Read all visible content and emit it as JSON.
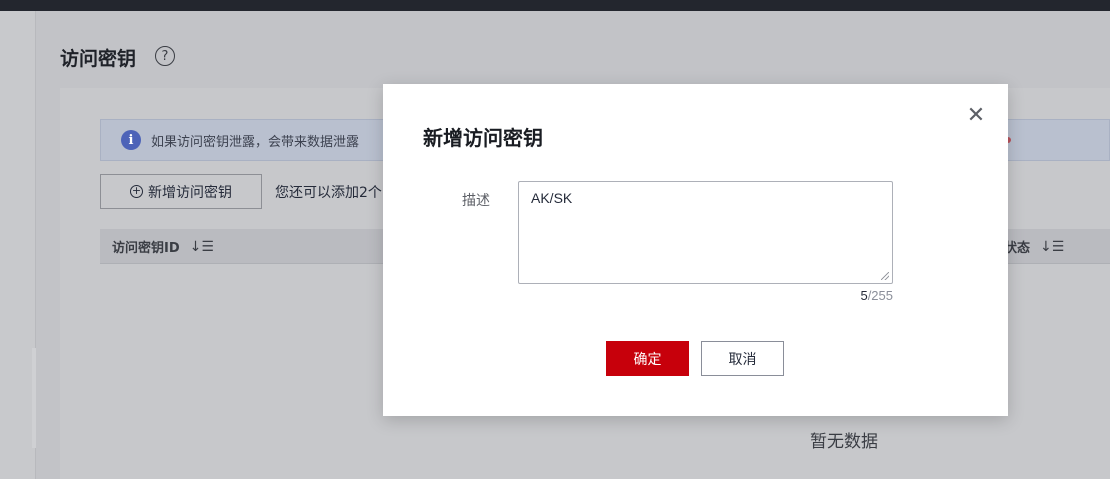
{
  "page": {
    "title": "访问密钥",
    "help_icon": "question-circle-icon"
  },
  "notice": {
    "icon": "info-icon",
    "text": "如果访问密钥泄露，会带来数据泄露"
  },
  "toolbar": {
    "add_button_label": "新增访问密钥",
    "limit_text": "您还可以添加2个"
  },
  "table": {
    "columns": [
      "访问密钥ID",
      "状态"
    ],
    "empty_text": "暂无数据"
  },
  "dialog": {
    "title": "新增访问密钥",
    "field_label": "描述",
    "description_value": "AK/SK",
    "counter_current": "5",
    "counter_max": "/255",
    "ok_label": "确定",
    "cancel_label": "取消",
    "accent_color": "#c7000b"
  }
}
